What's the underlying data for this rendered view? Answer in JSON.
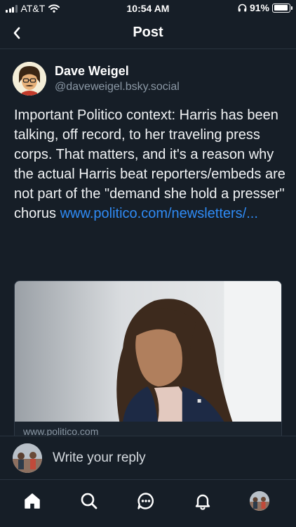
{
  "status_bar": {
    "carrier": "AT&T",
    "time": "10:54 AM",
    "battery_percent": "91%",
    "battery_level": 0.91
  },
  "header": {
    "title": "Post",
    "back_icon": "chevron-left-icon"
  },
  "post": {
    "author": {
      "display_name": "Dave Weigel",
      "handle": "@daveweigel.bsky.social"
    },
    "text": "Important Politico context: Harris has been talking, off record, to her traveling press corps. That matters, and it's a reason why the actual Harris beat reporters/embeds are not part of the \"demand she hold a presser\" chorus ",
    "link_text": "www.politico.com/newsletters/...",
    "link_card": {
      "domain": "www.politico.com"
    }
  },
  "reply_bar": {
    "placeholder": "Write your reply"
  },
  "tab_bar": {
    "items": [
      "home-icon",
      "search-icon",
      "chat-icon",
      "bell-icon",
      "profile-avatar"
    ]
  },
  "colors": {
    "background": "#161e27",
    "link": "#2f8bf5",
    "secondary_text": "#8b98a5",
    "divider": "#2a343f"
  }
}
